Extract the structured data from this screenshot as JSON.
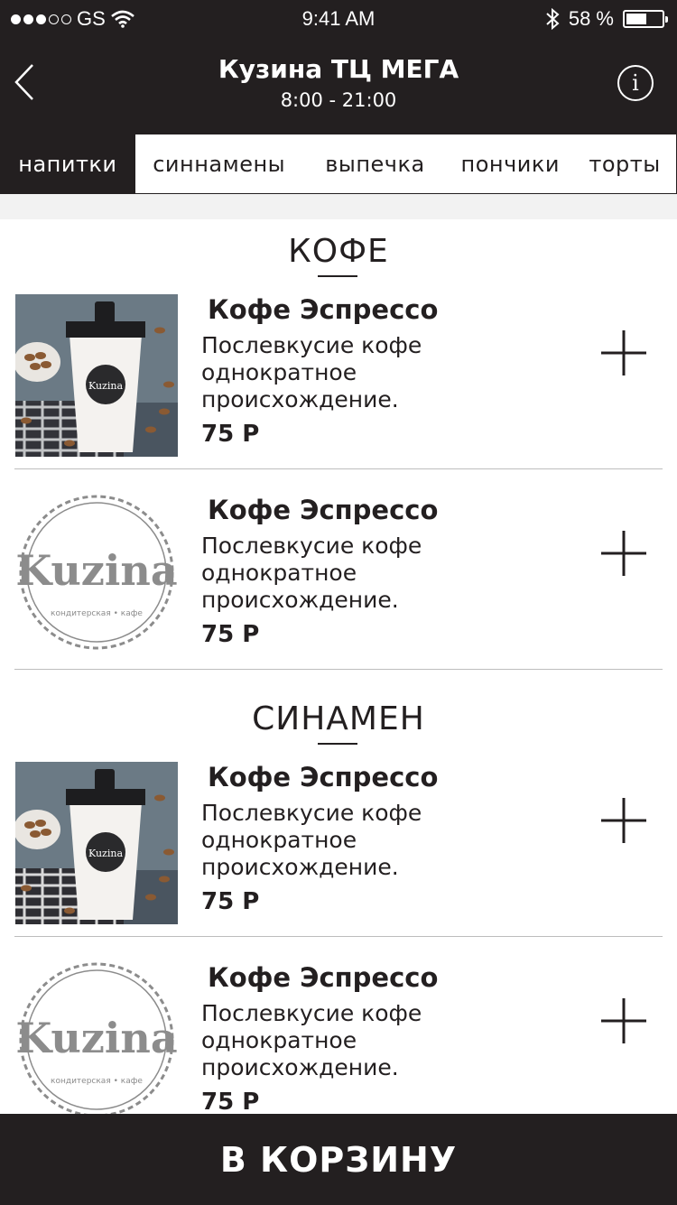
{
  "status_bar": {
    "carrier": "GS",
    "time": "9:41 AM",
    "battery": "58 %",
    "battery_level": 0.58
  },
  "header": {
    "title": "Кузина ТЦ МЕГА",
    "hours": "8:00 - 21:00"
  },
  "tabs": [
    {
      "label": "напитки",
      "active": true
    },
    {
      "label": "синнамены",
      "active": false
    },
    {
      "label": "выпечка",
      "active": false
    },
    {
      "label": "пончики",
      "active": false
    },
    {
      "label": "торты",
      "active": false
    }
  ],
  "sections": [
    {
      "title": "КОФЕ",
      "items": [
        {
          "name": "Кофе Эспрессо",
          "description": "Послевкусие кофе однократное происхождение.",
          "price": "75 Р",
          "image": "coffee-cup-photo"
        },
        {
          "name": "Кофе Эспрессо",
          "description": "Послевкусие кофе однократное происхождение.",
          "price": "75 Р",
          "image": "kuzina-logo"
        }
      ]
    },
    {
      "title": "СИНАМЕН",
      "items": [
        {
          "name": "Кофе Эспрессо",
          "description": "Послевкусие кофе однократное происхождение.",
          "price": "75 Р",
          "image": "coffee-cup-photo"
        },
        {
          "name": "Кофе Эспрессо",
          "description": "Послевкусие кофе однократное происхождение.",
          "price": "75 Р",
          "image": "kuzina-logo"
        }
      ]
    }
  ],
  "logo": {
    "wordmark": "Kuzina",
    "tagline": "кондитерская • кафе",
    "cup_wordmark": "Kuzina"
  },
  "footer": {
    "cart_label": "В КОРЗИНУ"
  },
  "colors": {
    "dark": "#231f20",
    "background": "#ffffff",
    "divider": "#bdbdbd",
    "gray_band": "#f2f2f2"
  }
}
